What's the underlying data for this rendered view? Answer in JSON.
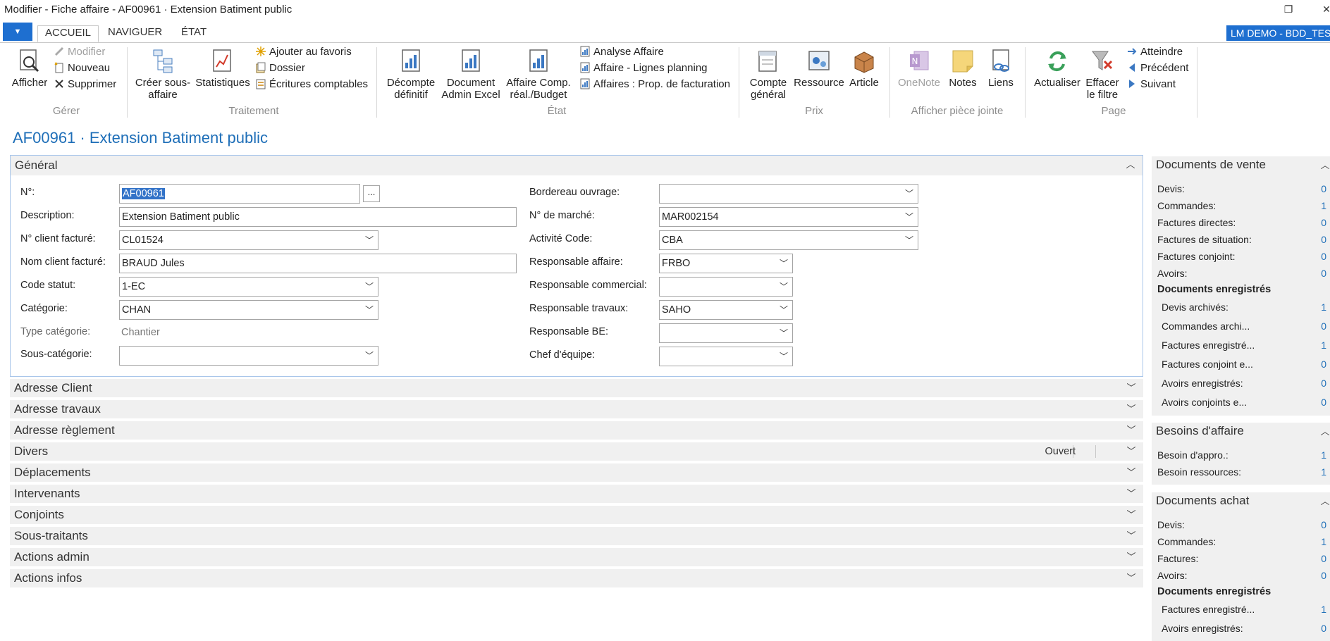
{
  "window": {
    "title": "Modifier - Fiche affaire - AF00961 · Extension Batiment public",
    "restore_glyph": "❐",
    "close_glyph": "✕"
  },
  "tabs": {
    "file_glyph": "▼",
    "items": [
      "ACCUEIL",
      "NAVIGUER",
      "ÉTAT"
    ],
    "company": "LM DEMO - BDD_TEST"
  },
  "ribbon": {
    "gerer": {
      "group": "Gérer",
      "afficher": "Afficher",
      "modifier": "Modifier",
      "nouveau": "Nouveau",
      "supprimer": "Supprimer"
    },
    "traitement": {
      "group": "Traitement",
      "creer_1": "Créer sous-",
      "creer_2": "affaire",
      "statistiques": "Statistiques",
      "favoris": "Ajouter au favoris",
      "dossier": "Dossier",
      "ecritures": "Écritures comptables"
    },
    "etat": {
      "group": "État",
      "decompte_1": "Décompte",
      "decompte_2": "définitif",
      "document_1": "Document",
      "document_2": "Admin Excel",
      "affcomp_1": "Affaire Comp.",
      "affcomp_2": "réal./Budget",
      "analyse": "Analyse Affaire",
      "lignes": "Affaire - Lignes planning",
      "prop": "Affaires : Prop. de facturation"
    },
    "prix": {
      "group": "Prix",
      "compte_1": "Compte",
      "compte_2": "général",
      "ressource": "Ressource",
      "article": "Article"
    },
    "piece": {
      "group": "Afficher pièce jointe",
      "onenote": "OneNote",
      "notes": "Notes",
      "liens": "Liens"
    },
    "page": {
      "group": "Page",
      "actualiser": "Actualiser",
      "effacer_1": "Effacer",
      "effacer_2": "le filtre",
      "atteindre": "Atteindre",
      "precedent": "Précédent",
      "suivant": "Suivant"
    }
  },
  "page_title": "AF00961 · Extension Batiment public",
  "general": {
    "title": "Général",
    "dots": "...",
    "left": [
      {
        "label": "N°:",
        "value": "AF00961"
      },
      {
        "label": "Description:",
        "value": "Extension Batiment public"
      },
      {
        "label": "N° client facturé:",
        "value": "CL01524"
      },
      {
        "label": "Nom client facturé:",
        "value": "BRAUD Jules"
      },
      {
        "label": "Code statut:",
        "value": "1-EC"
      },
      {
        "label": "Catégorie:",
        "value": "CHAN"
      },
      {
        "label": "Type catégorie:",
        "value": "Chantier"
      },
      {
        "label": "Sous-catégorie:",
        "value": ""
      }
    ],
    "right": [
      {
        "label": "Bordereau ouvrage:",
        "value": ""
      },
      {
        "label": "N° de marché:",
        "value": "MAR002154"
      },
      {
        "label": "Activité Code:",
        "value": "CBA"
      },
      {
        "label": "Responsable affaire:",
        "value": "FRBO"
      },
      {
        "label": "Responsable commercial:",
        "value": ""
      },
      {
        "label": "Responsable travaux:",
        "value": "SAHO"
      },
      {
        "label": "Responsable BE:",
        "value": ""
      },
      {
        "label": "Chef d'équipe:",
        "value": ""
      }
    ]
  },
  "fasttabs": [
    {
      "title": "Adresse Client"
    },
    {
      "title": "Adresse travaux"
    },
    {
      "title": "Adresse règlement"
    },
    {
      "title": "Divers",
      "summary": "Ouvert"
    },
    {
      "title": "Déplacements"
    },
    {
      "title": "Intervenants"
    },
    {
      "title": "Conjoints"
    },
    {
      "title": "Sous-traitants"
    },
    {
      "title": "Actions admin"
    },
    {
      "title": "Actions infos"
    }
  ],
  "factbox": {
    "vente": {
      "title": "Documents de vente",
      "rows": [
        {
          "label": "Devis:",
          "value": "0"
        },
        {
          "label": "Commandes:",
          "value": "1"
        },
        {
          "label": "Factures directes:",
          "value": "0"
        },
        {
          "label": "Factures de situation:",
          "value": "0"
        },
        {
          "label": "Factures conjoint:",
          "value": "0"
        },
        {
          "label": "Avoirs:",
          "value": "0"
        }
      ],
      "section": "Documents enregistrés",
      "posted": [
        {
          "label": "Devis archivés:",
          "value": "1"
        },
        {
          "label": "Commandes archi...",
          "value": "0"
        },
        {
          "label": "Factures enregistré...",
          "value": "1"
        },
        {
          "label": "Factures conjoint e...",
          "value": "0"
        },
        {
          "label": "Avoirs enregistrés:",
          "value": "0"
        },
        {
          "label": "Avoirs conjoints e...",
          "value": "0"
        }
      ]
    },
    "besoins": {
      "title": "Besoins d'affaire",
      "rows": [
        {
          "label": "Besoin d'appro.:",
          "value": "1"
        },
        {
          "label": "Besoin ressources:",
          "value": "1"
        }
      ]
    },
    "achat": {
      "title": "Documents achat",
      "rows": [
        {
          "label": "Devis:",
          "value": "0"
        },
        {
          "label": "Commandes:",
          "value": "1"
        },
        {
          "label": "Factures:",
          "value": "0"
        },
        {
          "label": "Avoirs:",
          "value": "0"
        }
      ],
      "section": "Documents enregistrés",
      "posted": [
        {
          "label": "Factures enregistré...",
          "value": "1"
        },
        {
          "label": "Avoirs enregistrés:",
          "value": "0"
        }
      ]
    }
  },
  "colors": {
    "accent": "#1e6fd0",
    "link": "#1f6fb8",
    "panel": "#f0f0f0"
  }
}
